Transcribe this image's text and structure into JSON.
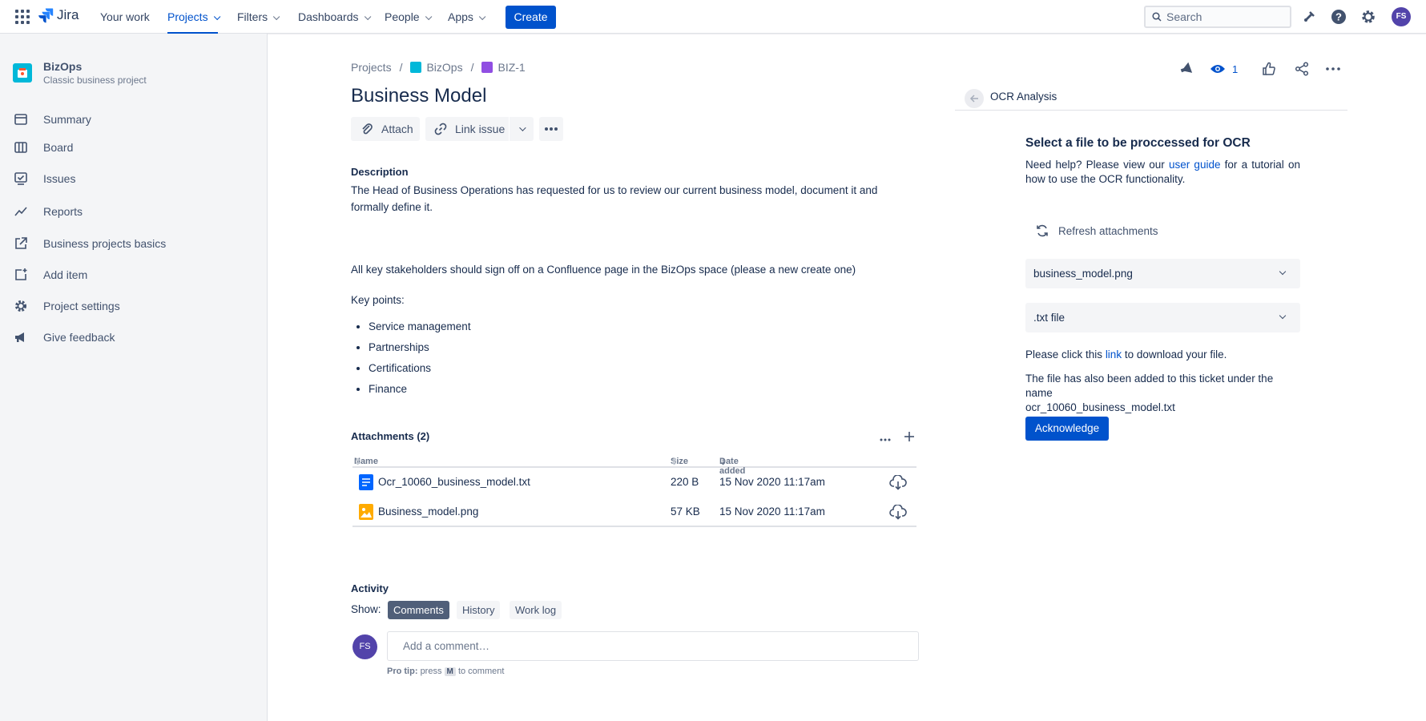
{
  "topnav": {
    "app_name": "Jira",
    "items": [
      {
        "label": "Your work"
      },
      {
        "label": "Projects"
      },
      {
        "label": "Filters"
      },
      {
        "label": "Dashboards"
      },
      {
        "label": "People"
      },
      {
        "label": "Apps"
      }
    ],
    "create_label": "Create",
    "search_placeholder": "Search",
    "user_initials": "FS"
  },
  "sidebar": {
    "project_name": "BizOps",
    "project_type": "Classic business project",
    "items": [
      {
        "label": "Summary",
        "icon": "summary-icon"
      },
      {
        "label": "Board",
        "icon": "board-icon"
      },
      {
        "label": "Issues",
        "icon": "issues-icon"
      },
      {
        "label": "Reports",
        "icon": "reports-icon"
      },
      {
        "label": "Business projects basics",
        "icon": "external-link-icon"
      },
      {
        "label": "Add item",
        "icon": "add-item-icon"
      },
      {
        "label": "Project settings",
        "icon": "gear-icon"
      },
      {
        "label": "Give feedback",
        "icon": "megaphone-icon"
      }
    ]
  },
  "breadcrumb": {
    "root": "Projects",
    "project": "BizOps",
    "issue_key": "BIZ-1"
  },
  "issue": {
    "title": "Business Model",
    "attach_label": "Attach",
    "link_issue_label": "Link issue",
    "description_label": "Description",
    "description_p1": "The Head of Business Operations has requested for us to review our current business model, document it and formally define it.",
    "description_p2": "All key stakeholders should sign off on a Confluence page in the BizOps space (please a new create one)",
    "key_points_label": "Key points:",
    "key_points": [
      "Service management",
      "Partnerships",
      "Certifications",
      "Finance"
    ]
  },
  "attachments": {
    "title": "Attachments (2)",
    "columns": {
      "name": "Name",
      "size": "Size",
      "date": "Date added"
    },
    "rows": [
      {
        "name": "Ocr_10060_business_model.txt",
        "size": "220 B",
        "date": "15 Nov 2020 11:17am"
      },
      {
        "name": "Business_model.png",
        "size": "57 KB",
        "date": "15 Nov 2020 11:17am"
      }
    ]
  },
  "activity": {
    "title": "Activity",
    "show_label": "Show:",
    "tabs": [
      "Comments",
      "History",
      "Work log"
    ],
    "active_tab": "Comments",
    "comment_placeholder": "Add a comment…",
    "avatar_initials": "FS",
    "protip_label": "Pro tip:",
    "protip_press": "press",
    "protip_key": "M",
    "protip_suffix": "to comment"
  },
  "actions": {
    "watch_count": "1"
  },
  "ocr": {
    "panel_title": "OCR Analysis",
    "heading": "Select a file to be proccessed for OCR",
    "help_prefix": "Need help? Please view our",
    "help_link": "user guide",
    "help_suffix": "for a tutorial on how to use the OCR functionality.",
    "refresh_label": "Refresh attachments",
    "file_select": "business_model.png",
    "format_select": ".txt file",
    "download_prefix": "Please click this",
    "download_link": "link",
    "download_suffix": "to download your file.",
    "added_note_1": "The file has also been added to this ticket under the name",
    "added_note_2": "ocr_10060_business_model.txt",
    "acknowledge_label": "Acknowledge"
  },
  "colors": {
    "brand_blue": "#0052cc",
    "sidebar_bg": "#f4f5f7",
    "avatar_purple": "#5243aa"
  }
}
